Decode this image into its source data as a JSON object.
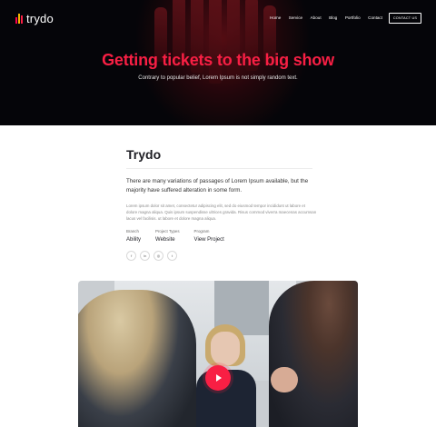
{
  "brand": {
    "name": "trydo",
    "colors": {
      "accent": "#f81f44",
      "logo_bars": [
        "#f9004d",
        "#f4b400",
        "#f81f44"
      ]
    }
  },
  "nav": {
    "items": [
      {
        "label": "Home"
      },
      {
        "label": "Service"
      },
      {
        "label": "About"
      },
      {
        "label": "Blog"
      },
      {
        "label": "Portfolio"
      },
      {
        "label": "Contact"
      }
    ],
    "cta_label": "CONTACT US"
  },
  "hero": {
    "title": "Getting tickets to the big show",
    "subtitle": "Contrary to popular belief, Lorem Ipsum is not simply random text."
  },
  "project": {
    "title": "Trydo",
    "lead": "There are many variations of passages of Lorem Ipsum available, but the majority have suffered alteration in some form.",
    "body": "Lorem ipsum dolor sit amet, consectetur adipiscing elit, sed do eiusmod tempor incididunt ut labore et dolore magna aliqua. Quis ipsum suspendisse ultrices gravida. Risus commod viverra maecenas accumsan lacus vel facilisis. ut labore et dolore magna aliqua.",
    "meta": [
      {
        "label": "Branch",
        "value": "Ability"
      },
      {
        "label": "Project Types",
        "value": "Website"
      },
      {
        "label": "Program",
        "value": "View Project"
      }
    ],
    "social": [
      {
        "icon": "facebook-icon",
        "glyph": "f"
      },
      {
        "icon": "linkedin-icon",
        "glyph": "in"
      },
      {
        "icon": "instagram-icon",
        "glyph": "◎"
      },
      {
        "icon": "twitter-icon",
        "glyph": "t"
      }
    ]
  },
  "video": {
    "icon": "play-icon"
  }
}
